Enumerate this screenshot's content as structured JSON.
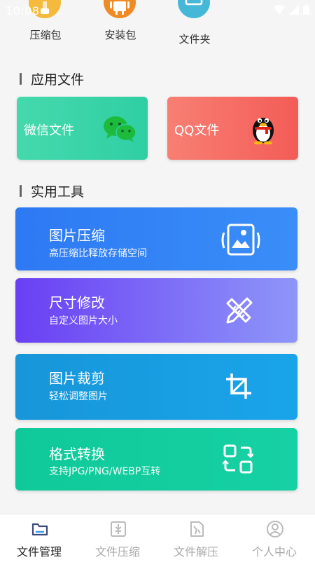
{
  "status_bar": {
    "time": "10:08"
  },
  "top_items": [
    {
      "label": "压缩包",
      "icon": "archive-icon",
      "color": "#f5b93b"
    },
    {
      "label": "安装包",
      "icon": "android-icon",
      "color": "#f08a24"
    },
    {
      "label": "文件夹",
      "icon": "folder-icon",
      "color": "#45b8d8"
    }
  ],
  "sections": {
    "app_files": "应用文件",
    "tools": "实用工具"
  },
  "app_cards": [
    {
      "label": "微信文件",
      "icon": "wechat-icon",
      "colors": [
        "#3fd6a8",
        "#2ccda0"
      ]
    },
    {
      "label": "QQ文件",
      "icon": "qq-penguin-icon",
      "colors": [
        "#f7766b",
        "#f35d57"
      ]
    }
  ],
  "tools": [
    {
      "title": "图片压缩",
      "subtitle": "高压缩比释放存储空间",
      "icon": "image-compress-icon"
    },
    {
      "title": "尺寸修改",
      "subtitle": "自定义图片大小",
      "icon": "ruler-pencil-icon"
    },
    {
      "title": "图片裁剪",
      "subtitle": "轻松调整图片",
      "icon": "crop-icon"
    },
    {
      "title": "格式转换",
      "subtitle": "支持JPG/PNG/WEBP互转",
      "icon": "convert-icon"
    }
  ],
  "bottom_nav": [
    {
      "label": "文件管理",
      "icon": "folder-manage-icon",
      "active": true
    },
    {
      "label": "文件压缩",
      "icon": "file-compress-icon",
      "active": false
    },
    {
      "label": "文件解压",
      "icon": "file-extract-icon",
      "active": false
    },
    {
      "label": "个人中心",
      "icon": "user-icon",
      "active": false
    }
  ]
}
